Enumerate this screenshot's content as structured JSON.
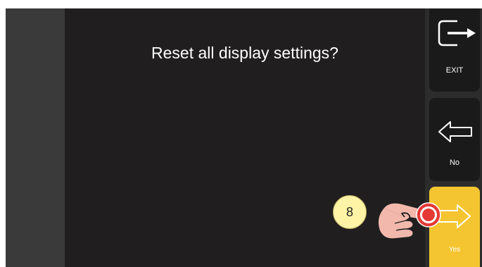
{
  "prompt": {
    "text": "Reset all display settings?"
  },
  "sidebar": {
    "exit": {
      "label": "EXIT",
      "icon": "exit-arrow-icon"
    },
    "no": {
      "label": "No",
      "icon": "arrow-left-icon"
    },
    "yes": {
      "label": "Yes",
      "icon": "arrow-right-icon"
    }
  },
  "annotation": {
    "step_number": "8",
    "pointer_icon": "hand-pointer-icon",
    "target_icon": "tap-target-icon"
  },
  "colors": {
    "screen_background": "#201e1f",
    "left_strip": "#3a3a3a",
    "button_dark": "#1a1a1a",
    "button_accent": "#f4c531",
    "text": "#ffffff",
    "badge": "#fff3a6",
    "tap_target": "#e53935"
  }
}
